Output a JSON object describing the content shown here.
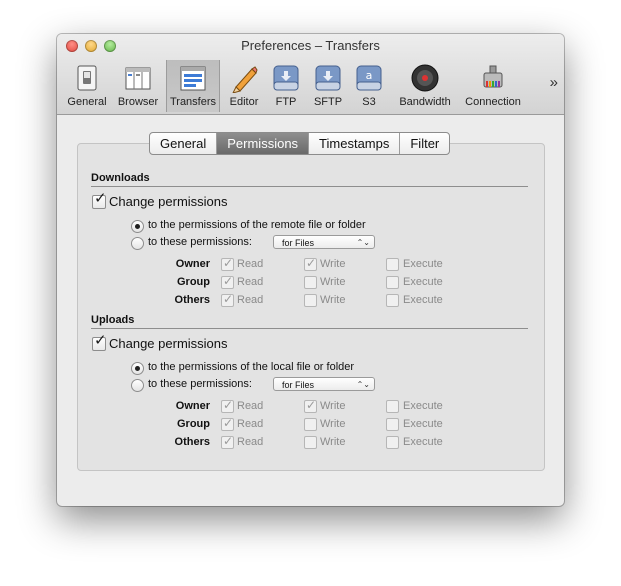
{
  "window": {
    "title": "Preferences – Transfers"
  },
  "toolbar": {
    "items": [
      {
        "label": "General",
        "icon": "switch-icon"
      },
      {
        "label": "Browser",
        "icon": "browser-icon"
      },
      {
        "label": "Transfers",
        "icon": "transfers-icon",
        "selected": true
      },
      {
        "label": "Editor",
        "icon": "pencil-icon"
      },
      {
        "label": "FTP",
        "icon": "ftp-disk-icon"
      },
      {
        "label": "SFTP",
        "icon": "sftp-disk-icon"
      },
      {
        "label": "S3",
        "icon": "s3-disk-icon"
      },
      {
        "label": "Bandwidth",
        "icon": "gauge-icon"
      },
      {
        "label": "Connection",
        "icon": "network-plug-icon"
      }
    ],
    "overflow": "»"
  },
  "tabs": {
    "general": "General",
    "permissions": "Permissions",
    "timestamps": "Timestamps",
    "filter": "Filter",
    "active": "Permissions"
  },
  "downloads": {
    "title": "Downloads",
    "change_permissions": {
      "label": "Change permissions",
      "checked": true
    },
    "option_remote": "to the permissions of the remote file or folder",
    "option_these": "to these permissions:",
    "selected_option": "remote",
    "popup": "for Files",
    "rows": [
      {
        "label": "Owner",
        "read": true,
        "write": true,
        "execute": false
      },
      {
        "label": "Group",
        "read": true,
        "write": false,
        "execute": false
      },
      {
        "label": "Others",
        "read": true,
        "write": false,
        "execute": false
      }
    ]
  },
  "uploads": {
    "title": "Uploads",
    "change_permissions": {
      "label": "Change permissions",
      "checked": true
    },
    "option_local": "to the permissions of the local file or folder",
    "option_these": "to these permissions:",
    "selected_option": "local",
    "popup": "for Files",
    "rows": [
      {
        "label": "Owner",
        "read": true,
        "write": true,
        "execute": false
      },
      {
        "label": "Group",
        "read": true,
        "write": false,
        "execute": false
      },
      {
        "label": "Others",
        "read": true,
        "write": false,
        "execute": false
      }
    ]
  },
  "perm_labels": {
    "read": "Read",
    "write": "Write",
    "execute": "Execute"
  },
  "popup_arrows": "⌃⌄"
}
